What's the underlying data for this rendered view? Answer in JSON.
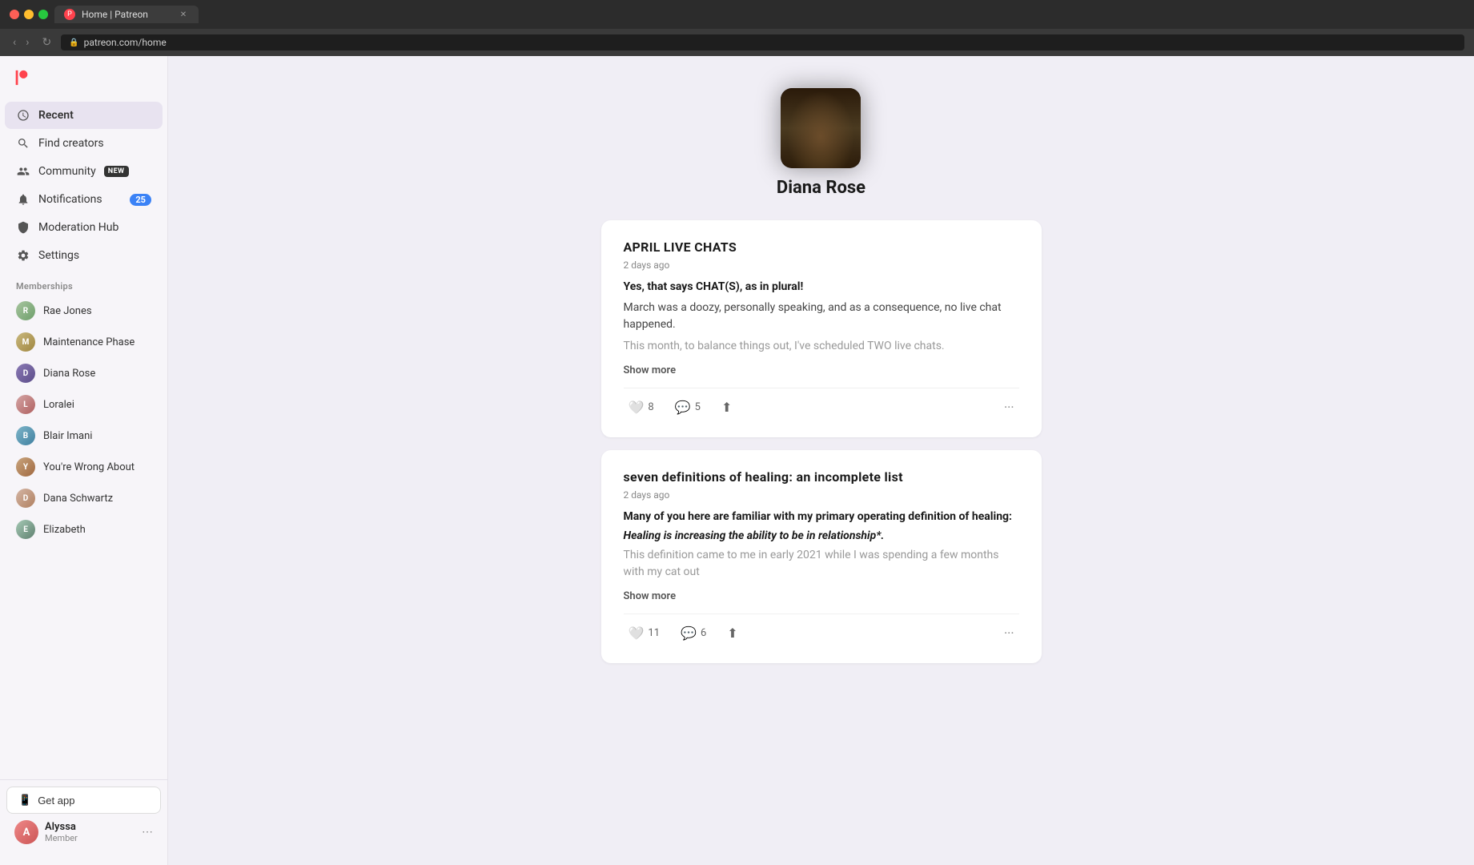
{
  "browser": {
    "tab_title": "Home | Patreon",
    "url": "patreon.com/home"
  },
  "sidebar": {
    "recent_label": "Recent",
    "find_creators_label": "Find creators",
    "community_label": "Community",
    "community_badge": "NEW",
    "notifications_label": "Notifications",
    "notifications_count": "25",
    "moderation_hub_label": "Moderation Hub",
    "settings_label": "Settings",
    "memberships_section": "Memberships",
    "get_app_label": "Get app",
    "memberships": [
      {
        "name": "Rae Jones",
        "av_class": "av-0"
      },
      {
        "name": "Maintenance Phase",
        "av_class": "av-1"
      },
      {
        "name": "Diana Rose",
        "av_class": "av-2"
      },
      {
        "name": "Loralei",
        "av_class": "av-3"
      },
      {
        "name": "Blair Imani",
        "av_class": "av-4"
      },
      {
        "name": "You're Wrong About",
        "av_class": "av-5"
      },
      {
        "name": "Dana Schwartz",
        "av_class": "av-6"
      },
      {
        "name": "Elizabeth",
        "av_class": "av-7"
      }
    ],
    "user": {
      "name": "Alyssa",
      "role": "Member"
    }
  },
  "profile": {
    "name": "Diana Rose"
  },
  "posts": [
    {
      "title": "APRIL LIVE CHATS",
      "date": "2 days ago",
      "body_bold": "Yes, that says CHAT(S), as in plural!",
      "body": "March was a doozy, personally speaking, and as a consequence, no live chat happened.",
      "body_muted": "This month, to balance things out, I've scheduled TWO live chats.",
      "show_more": "Show more",
      "likes": "8",
      "comments": "5"
    },
    {
      "title": "seven definitions of healing: an incomplete list",
      "date": "2 days ago",
      "body_bold": "Many of you here are familiar with my primary operating definition of healing:",
      "body_italic": "Healing is increasing the ability to be in relationship*.",
      "body_muted": "This definition came to me in early 2021 while I was spending a few months with my cat out",
      "show_more": "Show more",
      "likes": "11",
      "comments": "6"
    }
  ]
}
